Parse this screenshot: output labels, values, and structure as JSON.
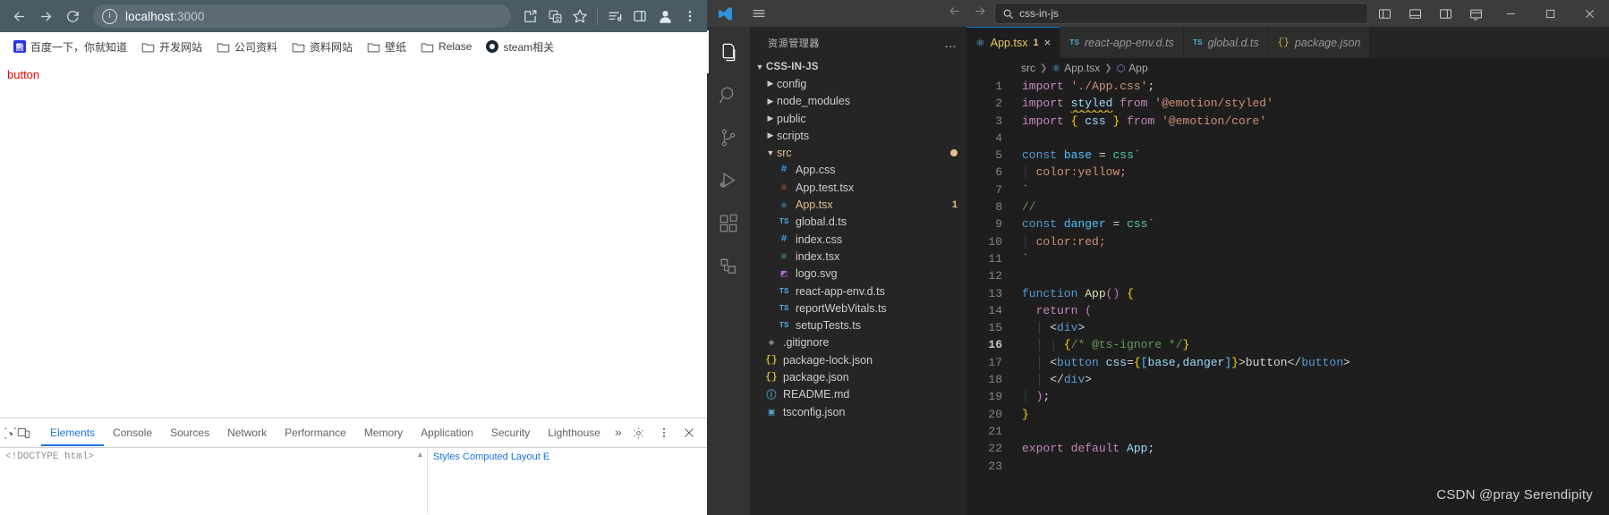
{
  "browser": {
    "nav": {
      "back": "back-arrow",
      "forward": "forward-arrow",
      "reload": "reload"
    },
    "omnibox": {
      "icon": "info-circle-icon",
      "url_host": "localhost",
      "url_port": ":3000",
      "value": "localhost:3000"
    },
    "toolbar_icons": [
      "install-app-icon",
      "translate-icon",
      "bookmark-star-icon",
      "reading-list-icon",
      "side-panel-icon",
      "profile-icon",
      "more-menu-icon"
    ],
    "bookmarks": [
      {
        "label": "百度一下，你就知道",
        "icon": "baidu-icon"
      },
      {
        "label": "开发网站",
        "icon": "folder-icon"
      },
      {
        "label": "公司资料",
        "icon": "folder-icon"
      },
      {
        "label": "资料网站",
        "icon": "folder-icon"
      },
      {
        "label": "壁纸",
        "icon": "folder-icon"
      },
      {
        "label": "Relase",
        "icon": "folder-icon"
      },
      {
        "label": "steam相关",
        "icon": "steam-icon"
      }
    ],
    "page": {
      "button_label": "button",
      "button_color": "#ff0000"
    }
  },
  "devtools": {
    "icons": [
      "inspect-element-icon",
      "device-toolbar-icon"
    ],
    "tabs": [
      {
        "label": "Elements",
        "active": true
      },
      {
        "label": "Console",
        "active": false
      },
      {
        "label": "Sources",
        "active": false
      },
      {
        "label": "Network",
        "active": false
      },
      {
        "label": "Performance",
        "active": false
      },
      {
        "label": "Memory",
        "active": false
      },
      {
        "label": "Application",
        "active": false
      },
      {
        "label": "Security",
        "active": false
      },
      {
        "label": "Lighthouse",
        "active": false
      }
    ],
    "overflow": "»",
    "right_icons": [
      "settings-gear-icon",
      "more-vertical-icon",
      "close-icon"
    ],
    "dom_snippet": "<!DOCTYPE html>",
    "styles_tabs": "Styles   Computed   Layout   E"
  },
  "vscode": {
    "titlebar": {
      "logo": "vscode-logo-icon",
      "menu": "hamburger-menu-icon",
      "search_icon": "search-icon",
      "search_text": "css-in-js",
      "nav_back": "back-arrow-icon",
      "nav_forward": "forward-arrow-icon",
      "layout_icons": [
        "panel-left-icon",
        "panel-bottom-icon",
        "panel-right-icon",
        "customize-layout-icon"
      ],
      "window_buttons": [
        "minimize",
        "maximize",
        "close"
      ]
    },
    "activitybar": [
      {
        "name": "explorer",
        "icon": "files-icon",
        "active": true
      },
      {
        "name": "search",
        "icon": "search-icon",
        "active": false
      },
      {
        "name": "source-control",
        "icon": "source-control-icon",
        "active": false
      },
      {
        "name": "run-debug",
        "icon": "run-debug-icon",
        "active": false
      },
      {
        "name": "extensions",
        "icon": "extensions-icon",
        "active": false
      },
      {
        "name": "remote-explorer",
        "icon": "remote-explorer-icon",
        "active": false
      }
    ],
    "sidebar": {
      "title": "资源管理器",
      "more": "…",
      "root": {
        "label": "CSS-IN-JS",
        "expanded": true
      },
      "tree": [
        {
          "label": "config",
          "type": "folder",
          "expanded": false,
          "indent": 1
        },
        {
          "label": "node_modules",
          "type": "folder",
          "expanded": false,
          "indent": 1
        },
        {
          "label": "public",
          "type": "folder",
          "expanded": false,
          "indent": 1
        },
        {
          "label": "scripts",
          "type": "folder",
          "expanded": false,
          "indent": 1
        },
        {
          "label": "src",
          "type": "folder",
          "expanded": true,
          "indent": 1,
          "modified": true,
          "dot": true
        },
        {
          "label": "App.css",
          "type": "css",
          "indent": 2
        },
        {
          "label": "App.test.tsx",
          "type": "react-test",
          "indent": 2
        },
        {
          "label": "App.tsx",
          "type": "react",
          "indent": 2,
          "selected": true,
          "modified": true,
          "badge": "1"
        },
        {
          "label": "global.d.ts",
          "type": "ts",
          "indent": 2
        },
        {
          "label": "index.css",
          "type": "css",
          "indent": 2
        },
        {
          "label": "index.tsx",
          "type": "react",
          "indent": 2
        },
        {
          "label": "logo.svg",
          "type": "svg",
          "indent": 2
        },
        {
          "label": "react-app-env.d.ts",
          "type": "ts",
          "indent": 2
        },
        {
          "label": "reportWebVitals.ts",
          "type": "ts",
          "indent": 2
        },
        {
          "label": "setupTests.ts",
          "type": "ts",
          "indent": 2
        },
        {
          "label": ".gitignore",
          "type": "git",
          "indent": 1
        },
        {
          "label": "package-lock.json",
          "type": "json",
          "indent": 1
        },
        {
          "label": "package.json",
          "type": "json",
          "indent": 1
        },
        {
          "label": "README.md",
          "type": "md",
          "indent": 1
        },
        {
          "label": "tsconfig.json",
          "type": "tsconfig",
          "indent": 1
        }
      ]
    },
    "tabs": [
      {
        "label": "App.tsx",
        "icon": "react-icon",
        "active": true,
        "badge": "1",
        "close": "×"
      },
      {
        "label": "react-app-env.d.ts",
        "icon": "ts-icon",
        "active": false,
        "italic": true
      },
      {
        "label": "global.d.ts",
        "icon": "ts-icon",
        "active": false,
        "italic": true
      },
      {
        "label": "package.json",
        "icon": "json-icon",
        "active": false,
        "italic": true
      }
    ],
    "breadcrumbs": [
      {
        "label": "src",
        "icon": ""
      },
      {
        "label": "App.tsx",
        "icon": "react-icon"
      },
      {
        "label": "App",
        "icon": "symbol-function-icon"
      }
    ],
    "editor": {
      "current_line": 16,
      "breakpoint_line": 6,
      "error_line": 9,
      "error_count": "1",
      "lines": [
        {
          "n": "1",
          "text": "import './App.css';"
        },
        {
          "n": "2",
          "text": "import styled from '@emotion/styled'"
        },
        {
          "n": "3",
          "text": "import { css } from '@emotion/core'"
        },
        {
          "n": "4",
          "text": ""
        },
        {
          "n": "5",
          "text": "const base = css`"
        },
        {
          "n": "6",
          "text": "  color:yellow;"
        },
        {
          "n": "7",
          "text": "`"
        },
        {
          "n": "8",
          "text": "//"
        },
        {
          "n": "9",
          "text": "const danger = css`"
        },
        {
          "n": "10",
          "text": "  color:red;"
        },
        {
          "n": "11",
          "text": "`"
        },
        {
          "n": "12",
          "text": ""
        },
        {
          "n": "13",
          "text": "function App() {"
        },
        {
          "n": "14",
          "text": "  return ("
        },
        {
          "n": "15",
          "text": "    <div>"
        },
        {
          "n": "16",
          "text": "      {/* @ts-ignore */}"
        },
        {
          "n": "17",
          "text": "      <button css={[base,danger]}>button</button>"
        },
        {
          "n": "18",
          "text": "    </div>"
        },
        {
          "n": "19",
          "text": "  );"
        },
        {
          "n": "20",
          "text": "}"
        },
        {
          "n": "21",
          "text": ""
        },
        {
          "n": "22",
          "text": "export default App;"
        },
        {
          "n": "23",
          "text": ""
        }
      ]
    },
    "watermark": "CSDN @pray Serendipity"
  },
  "colors": {
    "chrome_toolbar": "#4b5b66",
    "vscode_bg": "#1e1e1e",
    "vscode_sidebar": "#252526",
    "accent_blue": "#1a73e8",
    "tab_active_text": "#e7c664",
    "modified_badge": "#e2c08d",
    "page_button_red": "#ff0000"
  }
}
